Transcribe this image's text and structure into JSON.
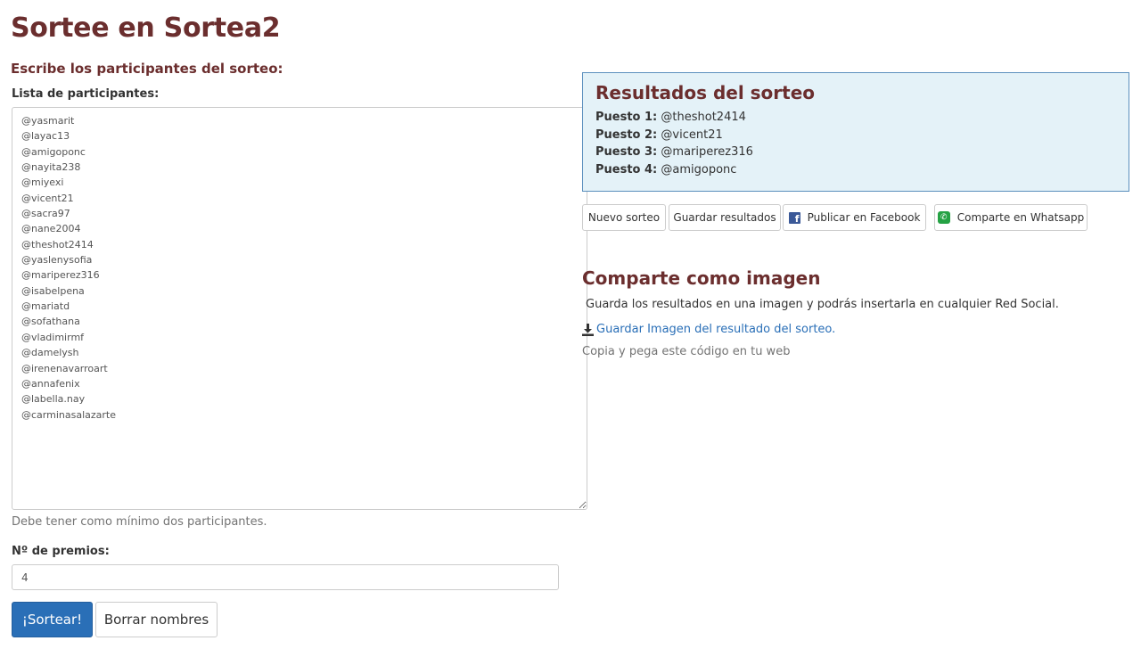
{
  "page": {
    "title": "Sortee en Sortea2",
    "subtitle": "Escribe los participantes del sorteo:"
  },
  "form": {
    "list_label": "Lista de participantes:",
    "participants": "@yasmarit\n@layac13\n@amigoponc\n@nayita238\n@miyexi\n@vicent21\n@sacra97\n@nane2004\n@theshot2414\n@yaslenysofia\n@mariperez316\n@isabelpena\n@mariatd\n@sofathana\n@vladimirmf\n@damelysh\n@irenenavarroart\n@annafenix\n@labella.nay\n@carminasalazarte",
    "help_text": "Debe tener como mínimo dos participantes.",
    "prizes_label": "Nº de premios:",
    "prizes_value": "4",
    "sortear_label": "¡Sortear!",
    "borrar_label": "Borrar nombres"
  },
  "results": {
    "title": "Resultados del sorteo",
    "items": [
      {
        "label": "Puesto 1:",
        "value": "@theshot2414"
      },
      {
        "label": "Puesto 2:",
        "value": "@vicent21"
      },
      {
        "label": "Puesto 3:",
        "value": "@mariperez316"
      },
      {
        "label": "Puesto 4:",
        "value": "@amigoponc"
      }
    ]
  },
  "actions": {
    "nuevo": "Nuevo sorteo",
    "guardar": "Guardar resultados",
    "facebook": "Publicar en Facebook",
    "whatsapp": "Comparte en Whatsapp"
  },
  "share": {
    "title": "Comparte como imagen",
    "description": "Guarda los resultados en una imagen y podrás insertarla en cualquier Red Social.",
    "download_link": "Guardar Imagen del resultado del sorteo.",
    "copy_text": "Copia y pega este código en tu web"
  },
  "colors": {
    "title": "#6b2e2e",
    "primary": "#2a6fb7",
    "results_bg": "#e4f2f8",
    "facebook": "#3b5998",
    "whatsapp": "#25a244"
  }
}
